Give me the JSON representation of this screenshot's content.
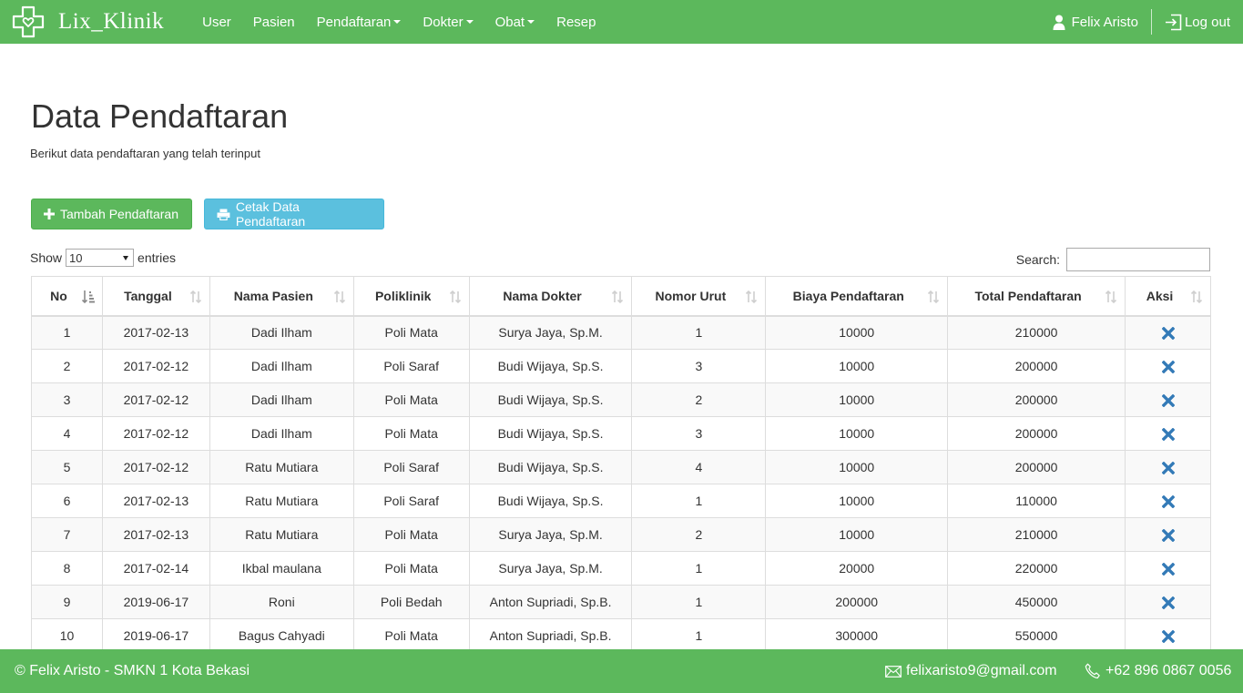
{
  "brand": {
    "name": "Lix_Klinik"
  },
  "nav": {
    "items": [
      {
        "label": "User",
        "dropdown": false
      },
      {
        "label": "Pasien",
        "dropdown": false
      },
      {
        "label": "Pendaftaran",
        "dropdown": true
      },
      {
        "label": "Dokter",
        "dropdown": true
      },
      {
        "label": "Obat",
        "dropdown": true
      },
      {
        "label": "Resep",
        "dropdown": false
      }
    ],
    "user_name": "Felix Aristo",
    "logout_label": "Log out"
  },
  "page": {
    "title": "Data Pendaftaran",
    "subtitle": "Berikut data pendaftaran yang telah terinput"
  },
  "actions": {
    "add_label": "Tambah Pendaftaran",
    "print_label": "Cetak Data Pendaftaran"
  },
  "table_controls": {
    "show_label": "Show",
    "entries_value": "10",
    "entries_label": "entries",
    "search_label": "Search:",
    "search_value": ""
  },
  "table": {
    "columns": [
      "No",
      "Tanggal",
      "Nama Pasien",
      "Poliklinik",
      "Nama Dokter",
      "Nomor Urut",
      "Biaya Pendaftaran",
      "Total Pendaftaran",
      "Aksi"
    ],
    "sorted_column": "No",
    "rows": [
      [
        "1",
        "2017-02-13",
        "Dadi Ilham",
        "Poli Mata",
        "Surya Jaya, Sp.M.",
        "1",
        "10000",
        "210000"
      ],
      [
        "2",
        "2017-02-12",
        "Dadi Ilham",
        "Poli Saraf",
        "Budi Wijaya, Sp.S.",
        "3",
        "10000",
        "200000"
      ],
      [
        "3",
        "2017-02-12",
        "Dadi Ilham",
        "Poli Mata",
        "Budi Wijaya, Sp.S.",
        "2",
        "10000",
        "200000"
      ],
      [
        "4",
        "2017-02-12",
        "Dadi Ilham",
        "Poli Mata",
        "Budi Wijaya, Sp.S.",
        "3",
        "10000",
        "200000"
      ],
      [
        "5",
        "2017-02-12",
        "Ratu Mutiara",
        "Poli Saraf",
        "Budi Wijaya, Sp.S.",
        "4",
        "10000",
        "200000"
      ],
      [
        "6",
        "2017-02-13",
        "Ratu Mutiara",
        "Poli Saraf",
        "Budi Wijaya, Sp.S.",
        "1",
        "10000",
        "110000"
      ],
      [
        "7",
        "2017-02-13",
        "Ratu Mutiara",
        "Poli Mata",
        "Surya Jaya, Sp.M.",
        "2",
        "10000",
        "210000"
      ],
      [
        "8",
        "2017-02-14",
        "Ikbal maulana",
        "Poli Mata",
        "Surya Jaya, Sp.M.",
        "1",
        "20000",
        "220000"
      ],
      [
        "9",
        "2019-06-17",
        "Roni",
        "Poli Bedah",
        "Anton Supriadi, Sp.B.",
        "1",
        "200000",
        "450000"
      ],
      [
        "10",
        "2019-06-17",
        "Bagus Cahyadi",
        "Poli Mata",
        "Anton Supriadi, Sp.B.",
        "1",
        "300000",
        "550000"
      ]
    ]
  },
  "footer": {
    "copyright": "© Felix Aristo - SMKN 1 Kota Bekasi",
    "email": "felixaristo9@gmail.com",
    "phone": "+62 896 0867 0056"
  },
  "colors": {
    "primary": "#5cb85c",
    "info": "#5bc0de",
    "delete_icon": "#337ab7"
  },
  "icons": {
    "brand": "cross-heart-icon",
    "user": "user-icon",
    "logout": "logout-icon",
    "add": "plus-icon",
    "print": "print-icon",
    "delete": "remove-icon",
    "sort": "sort-icon",
    "email": "envelope-icon",
    "phone": "phone-icon"
  }
}
